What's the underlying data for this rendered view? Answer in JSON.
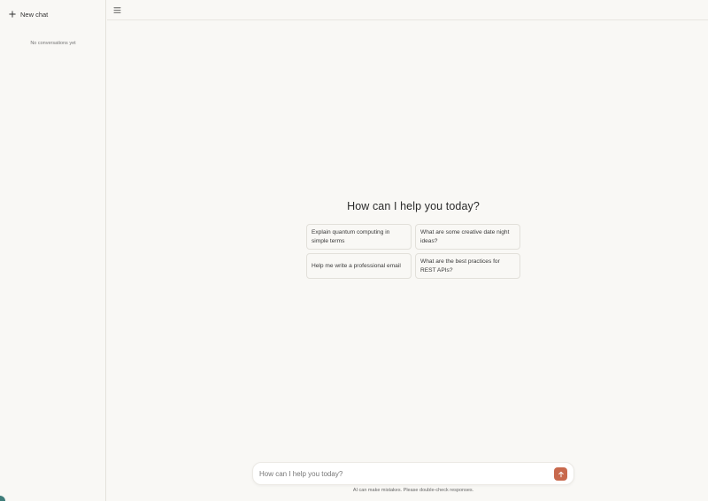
{
  "sidebar": {
    "new_chat_label": "New chat",
    "empty_text": "No conversations yet"
  },
  "topbar": {
    "menu_icon": "menu-icon"
  },
  "main": {
    "headline": "How can I help you today?",
    "suggestions": [
      "Explain quantum computing in simple terms",
      "What are some creative date night ideas?",
      "Help me write a professional email",
      "What are the best practices for REST APIs?"
    ]
  },
  "composer": {
    "placeholder": "How can I help you today?",
    "value": "",
    "send_icon": "arrow-up-icon",
    "disclaimer": "AI can make mistakes. Please double-check responses."
  },
  "colors": {
    "background": "#f9f8f5",
    "accent": "#c8694d",
    "border": "#e4e2dc"
  }
}
